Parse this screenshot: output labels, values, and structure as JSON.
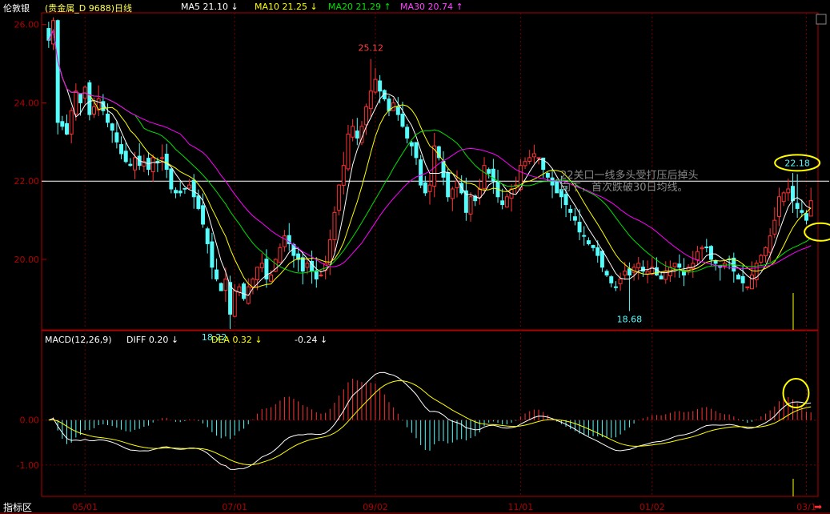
{
  "header": {
    "instrument": "伦敦银",
    "name": "(贵金属_D 9688)日线",
    "ma5": "MA5 21.10 ↓",
    "ma10": "MA10 21.25 ↓",
    "ma20": "MA20 21.29 ↑",
    "ma30": "MA30 20.74 ↑"
  },
  "macd_header": {
    "label": "MACD(12,26,9)",
    "diff": "DIFF  0.20 ↓",
    "dea": "DEA  0.32 ↓",
    "macd": "-0.24 ↓"
  },
  "annotation": {
    "line1": "22关口一线多头受打压后掉头",
    "line2": "向下，首次跌破30日均线。"
  },
  "footer": {
    "indicator_area": "指标区"
  },
  "colors": {
    "up": "#ff3232",
    "down": "#54fcfc",
    "ma5": "#ffffff",
    "ma10": "#ffff00",
    "ma20": "#00e000",
    "ma30": "#ff00ff",
    "highlight": "#ffff00",
    "axis": "#b00000"
  },
  "chart_data": [
    {
      "type": "candlestick",
      "title": "伦敦银 (贵金属_D 9688)日线",
      "y_ticks": [
        "26.00",
        "24.00",
        "22.00",
        "20.00"
      ],
      "ylim": [
        18.2,
        26.3
      ],
      "x_ticks": [
        "05/01",
        "07/01",
        "09/02",
        "11/01",
        "01/02",
        "03/1"
      ],
      "reference_line": 22.0,
      "annotations": [
        {
          "label": "25.12",
          "price": 25.12
        },
        {
          "label": "18.22",
          "price": 18.22
        },
        {
          "label": "18.68",
          "price": 18.68
        },
        {
          "label": "22.18",
          "price": 22.18
        }
      ],
      "series": [
        {
          "name": "MA5",
          "last": 21.1
        },
        {
          "name": "MA10",
          "last": 21.25
        },
        {
          "name": "MA20",
          "last": 21.29
        },
        {
          "name": "MA30",
          "last": 20.74
        }
      ],
      "close": [
        25.6,
        26.1,
        23.5,
        23.4,
        23.2,
        23.8,
        24.3,
        24.0,
        24.4,
        23.7,
        23.9,
        24.1,
        23.8,
        23.5,
        23.3,
        23.0,
        22.7,
        22.5,
        22.4,
        22.6,
        22.4,
        22.5,
        22.3,
        22.6,
        22.5,
        22.6,
        22.3,
        21.8,
        21.7,
        21.7,
        21.8,
        21.9,
        21.6,
        21.3,
        20.9,
        20.4,
        19.8,
        19.5,
        19.2,
        19.5,
        18.6,
        19.2,
        19.3,
        19.0,
        19.3,
        19.5,
        19.8,
        19.9,
        19.5,
        19.6,
        20.0,
        20.3,
        20.6,
        20.4,
        20.1,
        20.0,
        19.7,
        19.9,
        19.7,
        19.5,
        19.6,
        19.9,
        20.5,
        21.2,
        21.9,
        22.4,
        23.2,
        23.4,
        23.1,
        23.4,
        23.9,
        24.3,
        24.6,
        24.3,
        24.1,
        23.8,
        24.0,
        23.7,
        23.4,
        23.1,
        22.9,
        22.6,
        21.9,
        21.7,
        21.9,
        22.9,
        22.6,
        22.1,
        21.6,
        21.8,
        22.0,
        21.7,
        21.2,
        21.6,
        21.5,
        21.8,
        22.4,
        22.2,
        22.0,
        21.6,
        21.4,
        21.6,
        21.8,
        21.9,
        22.4,
        22.5,
        22.6,
        22.7,
        22.6,
        22.3,
        22.1,
        21.9,
        21.7,
        21.6,
        21.4,
        21.2,
        21.0,
        20.7,
        20.6,
        20.4,
        20.3,
        20.1,
        19.8,
        19.6,
        19.4,
        19.3,
        19.5,
        19.7,
        19.6,
        19.8,
        19.9,
        19.7,
        19.7,
        19.8,
        19.6,
        19.5,
        19.7,
        19.8,
        19.9,
        19.8,
        19.6,
        19.8,
        19.9,
        20.2,
        20.3,
        20.3,
        20.0,
        19.9,
        19.8,
        19.9,
        20.0,
        19.7,
        19.5,
        19.4,
        19.3,
        19.6,
        19.9,
        20.1,
        20.3,
        20.6,
        21.0,
        21.6,
        21.7,
        21.8,
        21.5,
        21.3,
        21.2,
        21.0,
        21.5
      ]
    },
    {
      "type": "macd",
      "title": "MACD(12,26,9)",
      "y_ticks": [
        "0.00",
        "-1.00"
      ],
      "ylim": [
        -1.7,
        1.6
      ],
      "series": [
        {
          "name": "DIFF",
          "last": 0.2
        },
        {
          "name": "DEA",
          "last": 0.32
        },
        {
          "name": "MACD",
          "last": -0.24
        }
      ]
    }
  ]
}
